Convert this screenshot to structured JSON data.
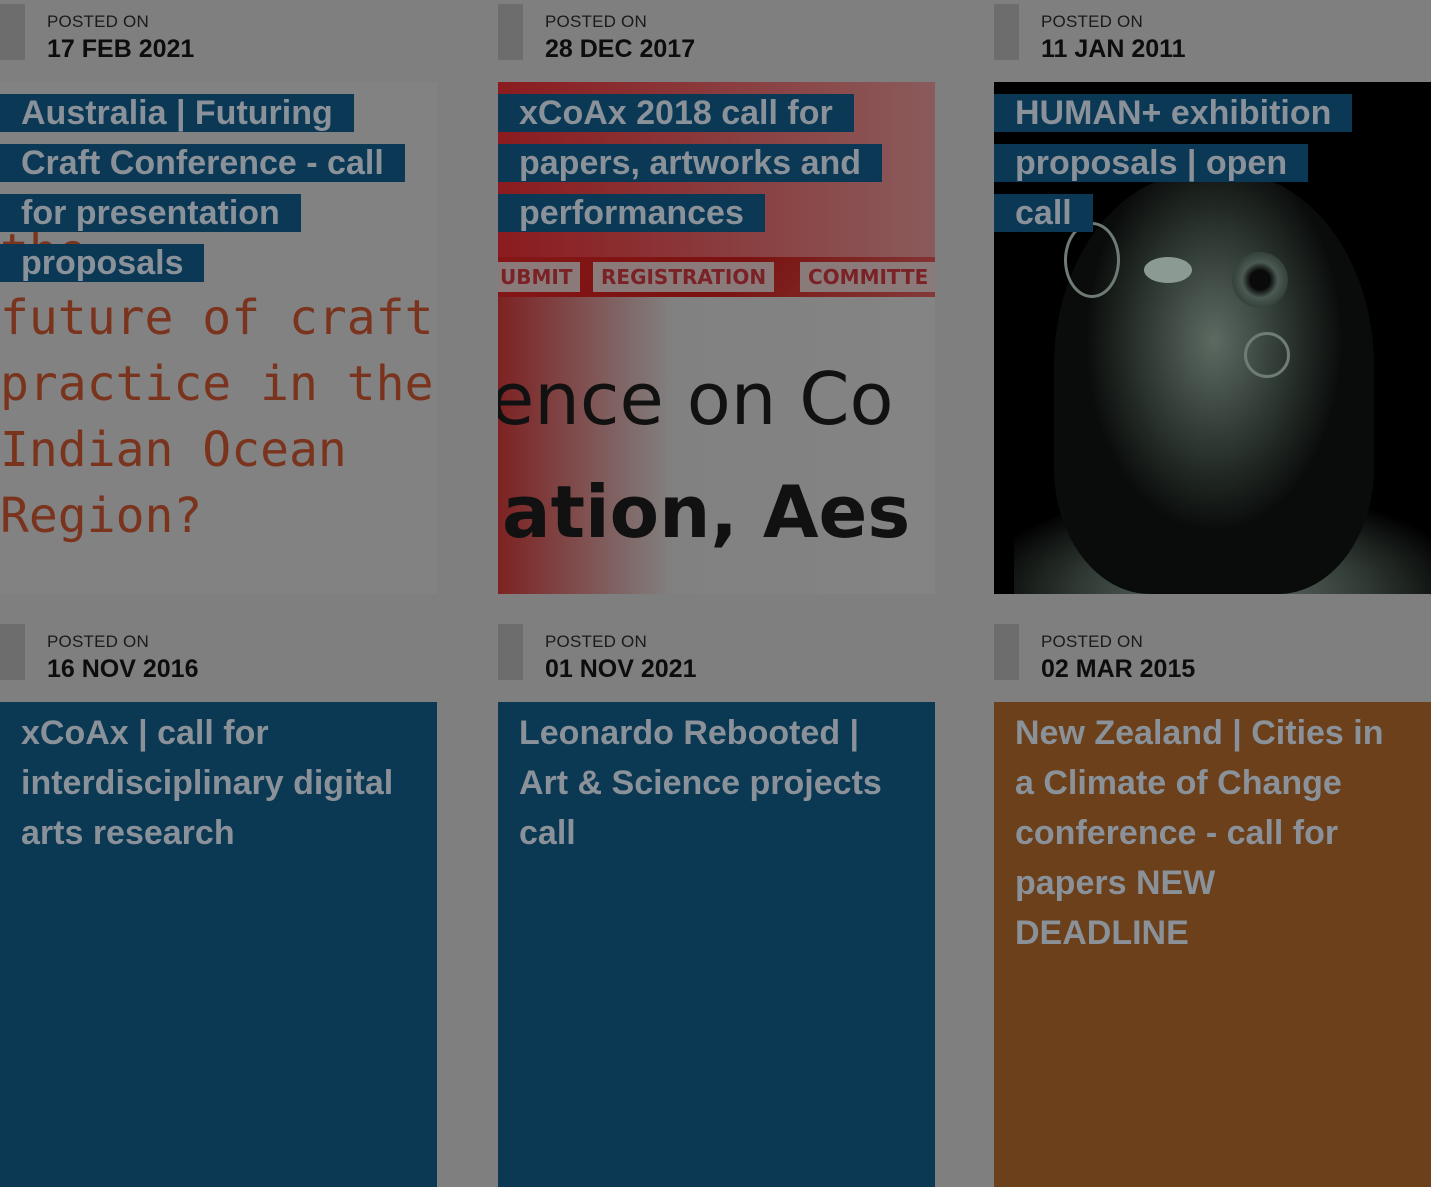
{
  "posts": [
    {
      "posted_label": "POSTED ON",
      "date": "17 FEB 2021",
      "title": "Australia | Futuring Craft Conference - call for presentation proposals",
      "image_text": "the\nfuture of craft\npractice in the\nIndian Ocean\nRegion?"
    },
    {
      "posted_label": "POSTED ON",
      "date": "28 DEC 2017",
      "title": "xCoAx 2018 call for papers, artworks and performances",
      "image_nav": [
        "UBMIT",
        "REGISTRATION",
        "COMMITTE"
      ],
      "image_line1": "ence on Co",
      "image_line2": "ation, Aes"
    },
    {
      "posted_label": "POSTED ON",
      "date": "11 JAN 2011",
      "title": "HUMAN+ exhibition proposals | open call"
    },
    {
      "posted_label": "POSTED ON",
      "date": "16 NOV 2016",
      "title": "xCoAx | call for interdisciplinary digital arts research",
      "card_color": "#0b3953"
    },
    {
      "posted_label": "POSTED ON",
      "date": "01 NOV 2021",
      "title": "Leonardo Rebooted | Art & Science projects call",
      "card_color": "#0b3953"
    },
    {
      "posted_label": "POSTED ON",
      "date": "02 MAR 2015",
      "title": "New Zealand | Cities in a Climate of Change conference - call for papers NEW DEADLINE",
      "card_color": "#6b401b"
    }
  ],
  "colors": {
    "overlay": "#7f7f7f",
    "title_background": "#0b3955",
    "title_text": "#8a9199",
    "date_bar": "#6d6d6d"
  }
}
